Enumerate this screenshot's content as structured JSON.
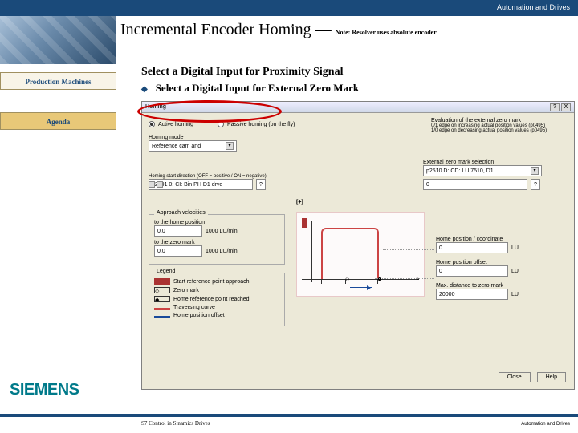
{
  "header": {
    "topbar": "Automation and Drives"
  },
  "slide": {
    "title": "Incremental Encoder Homing",
    "dash": " — ",
    "note": "Note: Resolver uses absolute encoder",
    "line1": "Select a Digital Input for Proximity Signal",
    "bullet_dot": "◆",
    "line2": "Select a Digital Input for External Zero Mark"
  },
  "sidebar": {
    "item1": "Production Machines",
    "item2": "Agenda"
  },
  "brand": "SIEMENS",
  "footer": {
    "left": "S7 Control in Sinamics Drives",
    "right": "Automation and Drives"
  },
  "dialog": {
    "title": "Homing",
    "win_help": "?",
    "win_close": "X",
    "radio1": "Active homing",
    "radio2": "Passive homing (on the fly)",
    "eval_title": "Evaluation of the external zero mark",
    "eval_line2": "0/1 edge on increasing actual position values (p0495)",
    "eval_line3": "1/0 edge on decreasing actual position values (p0495)",
    "mode_label": "Homing mode",
    "mode_value": "Reference cam and",
    "startdir_label": "Homing start direction (OFF = positive / ON = negative)",
    "startdir_value": "p2091 0: CI: Bin PH D1 drve",
    "ext_label": "External zero mark selection",
    "ext_value": "p2510 D: CD: LU 7510, D1",
    "ext_number": "0",
    "ext_help": "?",
    "approach_title": "Approach velocities",
    "approach1_label": "to the home position",
    "approach1_value": "0.0",
    "approach1_unit": "1000 LU/min",
    "approach2_label": "to the zero mark",
    "approach2_value": "0.0",
    "approach2_unit": "1000 LU/min",
    "legend_title": "Legend",
    "legend1": "Start reference point approach",
    "legend2": "Zero mark",
    "legend3": "Home reference point reached",
    "legend4": "Traversing curve",
    "legend5": "Home position offset",
    "rhs1_label": "Home position / coordinate",
    "rhs1_value": "0",
    "rhs1_unit": "LU",
    "rhs2_label": "Home position offset",
    "rhs2_value": "0",
    "rhs2_unit": "LU",
    "rhs3_label": "Max. distance to zero mark",
    "rhs3_value": "20000",
    "rhs3_unit": "LU",
    "diagram": {
      "xlabel": "s",
      "plus": "[+]"
    },
    "btn_close": "Close",
    "btn_help": "Help"
  }
}
